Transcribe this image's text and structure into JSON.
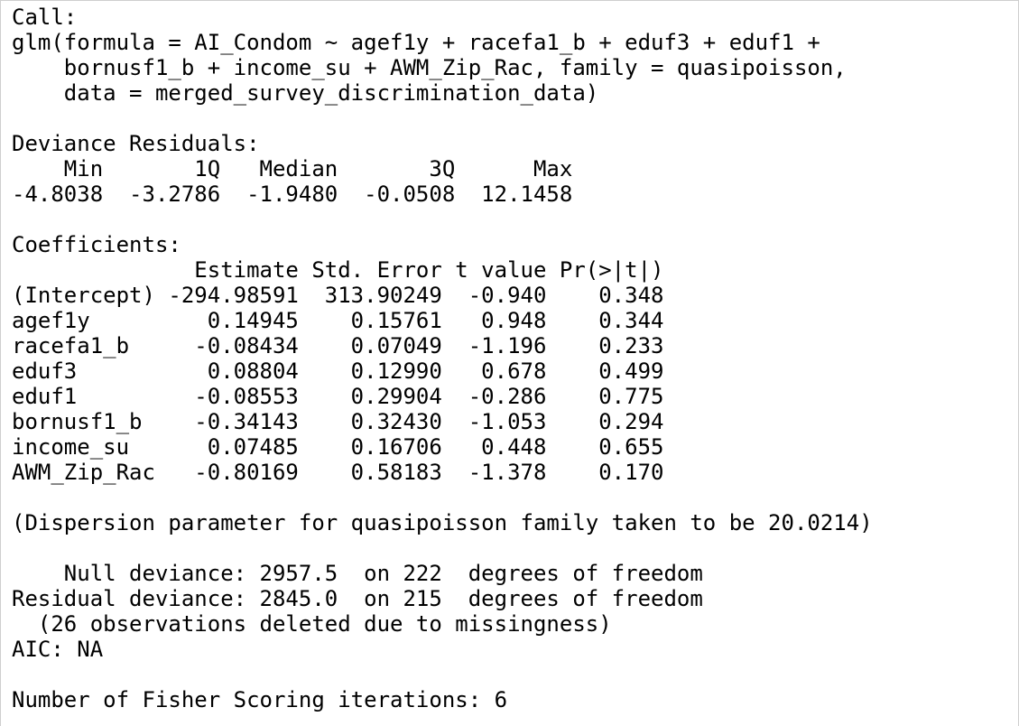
{
  "console": {
    "lines": [
      "Call:",
      "glm(formula = AI_Condom ~ agef1y + racefa1_b + eduf3 + eduf1 +",
      "    bornusf1_b + income_su + AWM_Zip_Rac, family = quasipoisson,",
      "    data = merged_survey_discrimination_data)",
      "",
      "Deviance Residuals:",
      "    Min       1Q   Median       3Q      Max",
      "-4.8038  -3.2786  -1.9480  -0.0508  12.1458",
      "",
      "Coefficients:",
      "              Estimate Std. Error t value Pr(>|t|)",
      "(Intercept) -294.98591  313.90249  -0.940    0.348",
      "agef1y         0.14945    0.15761   0.948    0.344",
      "racefa1_b     -0.08434    0.07049  -1.196    0.233",
      "eduf3          0.08804    0.12990   0.678    0.499",
      "eduf1         -0.08553    0.29904  -0.286    0.775",
      "bornusf1_b    -0.34143    0.32430  -1.053    0.294",
      "income_su      0.07485    0.16706   0.448    0.655",
      "AWM_Zip_Rac   -0.80169    0.58183  -1.378    0.170",
      "",
      "(Dispersion parameter for quasipoisson family taken to be 20.0214)",
      "",
      "    Null deviance: 2957.5  on 222  degrees of freedom",
      "Residual deviance: 2845.0  on 215  degrees of freedom",
      "  (26 observations deleted due to missingness)",
      "AIC: NA",
      "",
      "Number of Fisher Scoring iterations: 6"
    ]
  }
}
